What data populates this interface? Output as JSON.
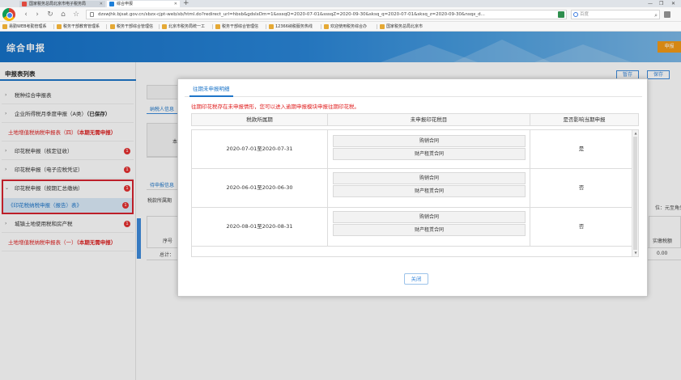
{
  "browser": {
    "tabs": [
      {
        "title": "国家税务总局北京市电子税务局"
      },
      {
        "title": "综合申报"
      }
    ],
    "new_tab": "+",
    "url": "dzswjhk.bjsat.gov.cn/sbzx-cjpt-web/sb/html.do?redirect_url=hbsb&gdslxDm=1&sssqQ=2020-07-01&sssqZ=2020-09-30&sksq_q=2020-07-01&sksq_z=2020-09-30&nsqx_d...",
    "search_placeholder": "百度",
    "bookmarks": [
      {
        "label": "易勤WEB考勤管理系"
      },
      {
        "label": "税务干部教育管理系"
      },
      {
        "label": "税务干部综合管理信"
      },
      {
        "label": "北京市税务局统一工"
      },
      {
        "label": "税务干部综合管理信"
      },
      {
        "label": "12366纳税服务热线"
      },
      {
        "label": "欢迎使用税务综合办"
      },
      {
        "label": "国家税务总局北京市"
      }
    ]
  },
  "header": {
    "title": "综合申报",
    "declare_label": "申报"
  },
  "sidebar": {
    "title": "申报表列表",
    "items": [
      {
        "label": "税种综合申报表",
        "arrow": "›",
        "tag": "",
        "red": false,
        "badge": ""
      },
      {
        "label": "企业所得税月季度申报（A类）",
        "arrow": "›",
        "tag": "（已保存）",
        "red": false,
        "badge": ""
      },
      {
        "label": "土地增值税纳税申报表（四）",
        "arrow": "",
        "tag": "（本期无需申报）",
        "red": true,
        "badge": ""
      },
      {
        "label": "印花税申报（核定征收）",
        "arrow": "›",
        "tag": "",
        "red": false,
        "badge": "1"
      },
      {
        "label": "印花税申报（电子应税凭证）",
        "arrow": "›",
        "tag": "",
        "red": false,
        "badge": "1"
      },
      {
        "label": "印花税申报（按期汇总缴纳）",
        "arrow": "⌄",
        "tag": "",
        "red": false,
        "badge": "1"
      },
      {
        "label": "城镇土地使用税和房产税",
        "arrow": "›",
        "tag": "",
        "red": false,
        "badge": "1"
      },
      {
        "label": "土地增值税纳税申报表（一）",
        "arrow": "",
        "tag": "（本期无需申报）",
        "red": true,
        "badge": ""
      }
    ],
    "sub_item": {
      "label": "《印花税纳税申报（报告）表》",
      "badge": "1"
    }
  },
  "main": {
    "stash_label": "暂存",
    "save_label": "保存",
    "taxpayer_tab": "纳税人信息",
    "pending_tab": "待申报信息",
    "period_label": "税款所属期",
    "unit_label": "位：元至角分",
    "seq_label": "序号",
    "total_label": "总计：",
    "deduct_label": "实缴税额",
    "deduct_value": "0.00",
    "ben_label": "本"
  },
  "modal": {
    "tab_label": "往期未申报明细",
    "warning": "往期印花税存在未申报情形，您可以进入逾期申报模块申报往期印花税。",
    "columns": [
      "税款所属期",
      "未申报印花税目",
      "是否影响当期申报"
    ],
    "rows": [
      {
        "period": "2020-07-01至2020-07-31",
        "items": [
          "购销合同",
          "财产租赁合同"
        ],
        "affect": "是"
      },
      {
        "period": "2020-06-01至2020-06-30",
        "items": [
          "购销合同",
          "财产租赁合同"
        ],
        "affect": "否"
      },
      {
        "period": "2020-08-01至2020-08-31",
        "items": [
          "购销合同",
          "财产租赁合同"
        ],
        "affect": "否"
      }
    ],
    "close_label": "关闭"
  }
}
